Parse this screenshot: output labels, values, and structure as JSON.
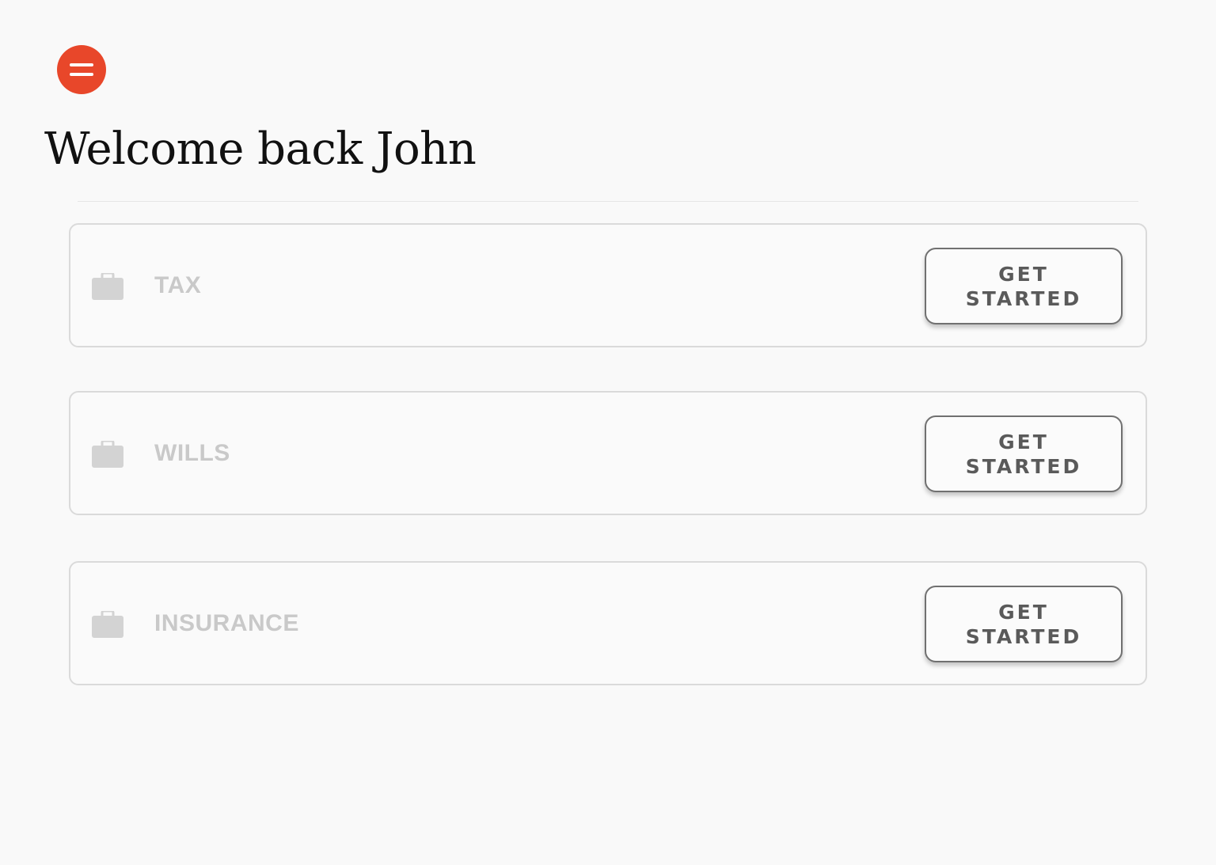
{
  "header": {
    "menu_icon": "hamburger-menu-icon",
    "menu_color": "#e8472a",
    "title": "Welcome back John"
  },
  "services": [
    {
      "label": "TAX",
      "icon": "briefcase-icon",
      "button_line1": "GET",
      "button_line2": "STARTED"
    },
    {
      "label": "WILLS",
      "icon": "briefcase-icon",
      "button_line1": "GET",
      "button_line2": "STARTED"
    },
    {
      "label": "INSURANCE",
      "icon": "briefcase-icon",
      "button_line1": "GET",
      "button_line2": "STARTED"
    }
  ]
}
